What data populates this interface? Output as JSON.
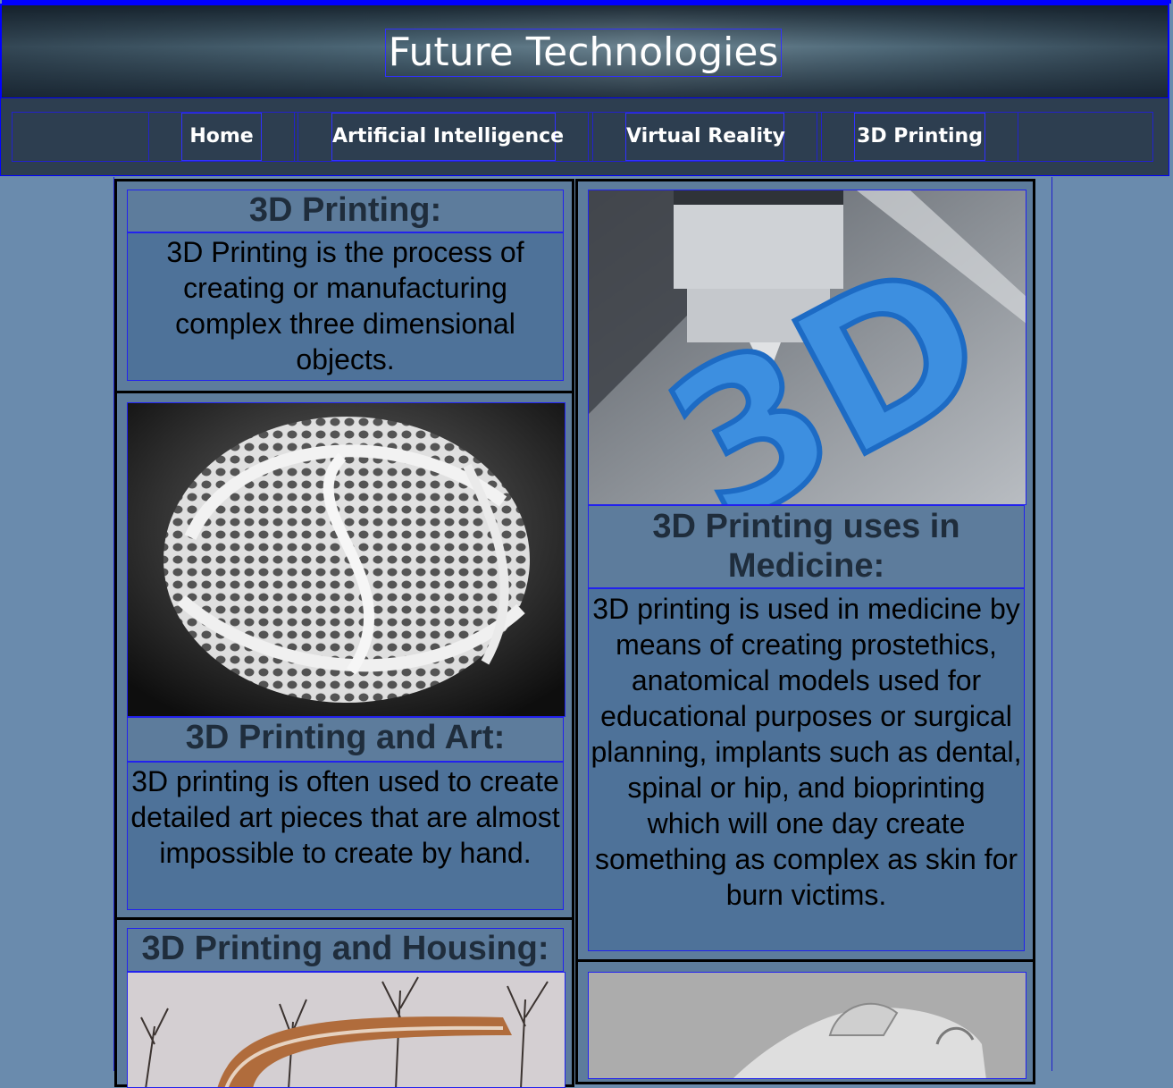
{
  "header": {
    "title": "Future Technologies"
  },
  "nav": {
    "items": [
      {
        "label": "Home"
      },
      {
        "label": "Artificial Intelligence"
      },
      {
        "label": "Virtual Reality"
      },
      {
        "label": "3D Printing"
      }
    ]
  },
  "cards": {
    "intro": {
      "title": "3D Printing:",
      "text": "3D Printing is the process of creating or manufacturing complex three dimensional objects."
    },
    "art": {
      "title": "3D Printing and Art:",
      "text": "3D printing is often used to create detailed art pieces that are almost impossible to create by hand."
    },
    "housing": {
      "title": "3D Printing and Housing:"
    },
    "medicine": {
      "title": "3D Printing uses in Medicine:",
      "text": "3D printing is used in medicine by means of creating prostethics, anatomical models used for educational purposes or surgical planning, implants such as dental, spinal or hip, and bioprinting which will one day create something as complex as skin for burn victims."
    }
  },
  "images": {
    "printer": "3d-printer-printing-3d-letters-image",
    "sculpture": "3d-printed-lattice-sculpture-image",
    "house": "3d-printed-house-image",
    "car": "3d-printed-car-image"
  },
  "colors": {
    "page_background": "#6a8bad",
    "nav_background": "#2d3e50",
    "card_background": "#5d7c9c",
    "text_box_background": "#4e7299",
    "outline": "#0000ff"
  }
}
